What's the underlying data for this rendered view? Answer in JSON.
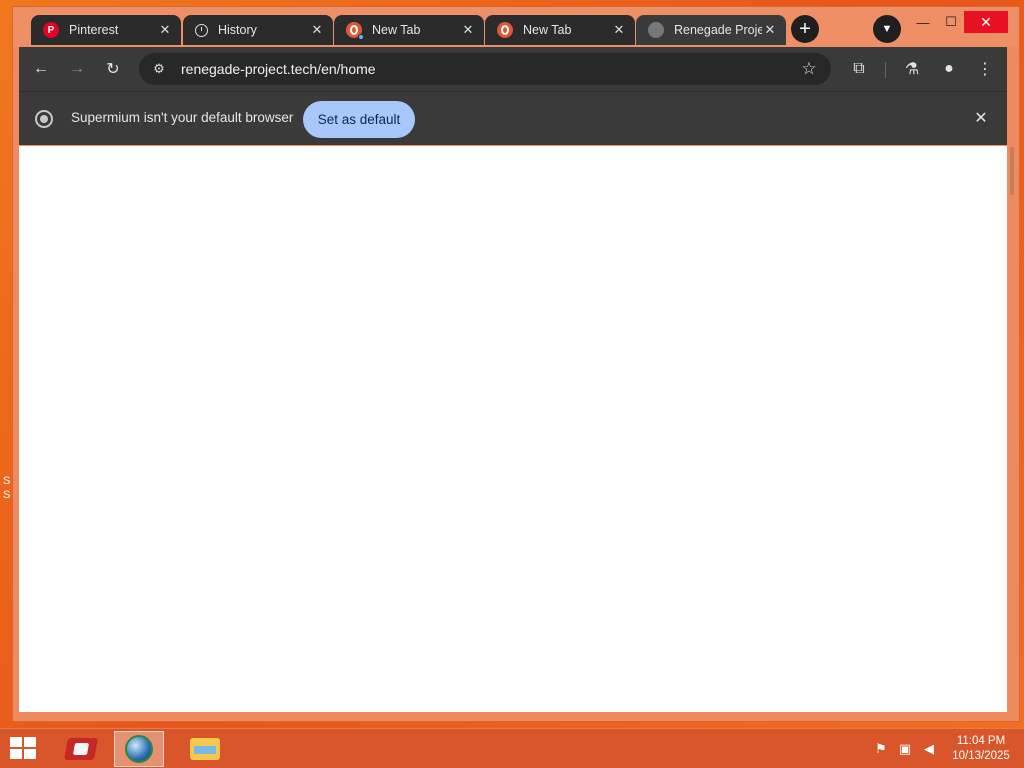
{
  "browser": {
    "tabs": [
      {
        "title": "Pinterest",
        "icon": "pinterest-icon"
      },
      {
        "title": "History",
        "icon": "history-icon"
      },
      {
        "title": "New Tab",
        "icon": "duckduckgo-icon"
      },
      {
        "title": "New Tab",
        "icon": "duckduckgo-icon"
      },
      {
        "title": "Renegade Project",
        "icon": "globe-icon",
        "active": true
      }
    ],
    "address": {
      "url": "renegade-project.tech/en/home"
    },
    "infobar": {
      "message": "Supermium isn't your default browser",
      "button_label": "Set as default"
    }
  },
  "taskbar": {
    "clock": {
      "time": "11:04 PM",
      "date": "10/13/2025"
    }
  },
  "desktop": {
    "edge_letters": [
      "S",
      "S"
    ]
  },
  "colors": {
    "desktop_bg": "#e8561a",
    "tab_bg": "#2b2b2b",
    "accent_button": "#a8c7fa"
  }
}
